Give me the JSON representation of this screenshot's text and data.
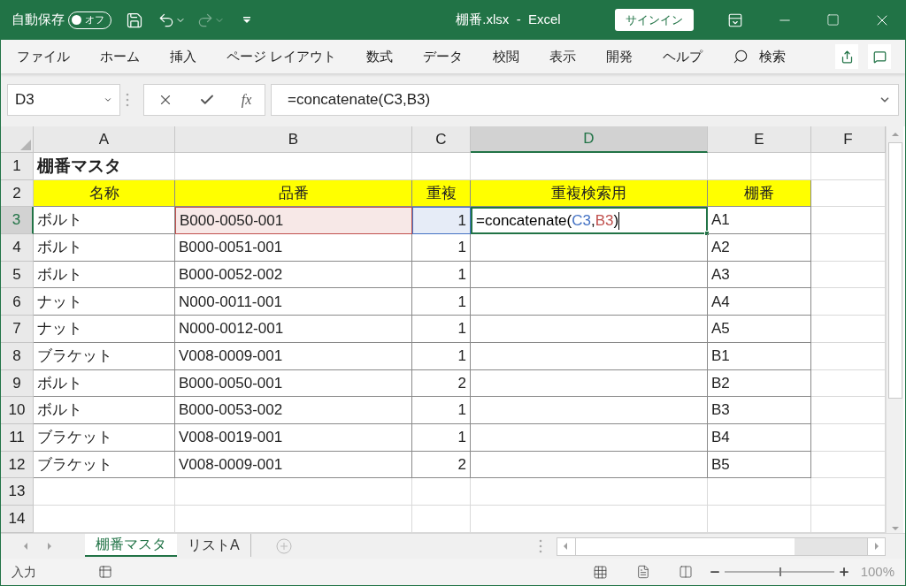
{
  "title_bar": {
    "autosave_label": "自動保存",
    "autosave_toggle": {
      "label": "オフ",
      "on": false
    },
    "redo_disabled": true,
    "title": "棚番.xlsx  -  Excel",
    "signin": "サインイン"
  },
  "ribbon": {
    "tabs": [
      "ファイル",
      "ホーム",
      "挿入",
      "ページ レイアウト",
      "数式",
      "データ",
      "校閲",
      "表示",
      "開発",
      "ヘルプ"
    ],
    "search": "検索"
  },
  "formula_bar": {
    "name_box": "D3",
    "fx": "fx",
    "formula": "=concatenate(C3,B3)"
  },
  "sheet": {
    "columns": [
      {
        "label": "A",
        "selected": false
      },
      {
        "label": "B",
        "selected": false
      },
      {
        "label": "C",
        "selected": false
      },
      {
        "label": "D",
        "selected": true
      },
      {
        "label": "E",
        "selected": false
      },
      {
        "label": "F",
        "selected": false
      }
    ],
    "rows": [
      {
        "header": "1",
        "selected": false,
        "kind": "title",
        "cells": [
          {
            "text": "棚番マスタ"
          },
          {},
          {},
          {},
          {},
          {}
        ]
      },
      {
        "header": "2",
        "selected": false,
        "kind": "header",
        "cells": [
          {
            "text": "名称"
          },
          {
            "text": "品番"
          },
          {
            "text": "重複"
          },
          {
            "text": "重複検索用"
          },
          {
            "text": "棚番"
          },
          {}
        ]
      },
      {
        "header": "3",
        "selected": true,
        "kind": "data",
        "cells": [
          {
            "text": "ボルト"
          },
          {
            "text": "B000-0050-001",
            "color": "#c0504d"
          },
          {
            "text": "1",
            "color": "#4472c4"
          },
          {
            "editing": true,
            "parts": [
              {
                "text": "=concatenate("
              },
              {
                "text": "C3",
                "color": "#4472c4"
              },
              {
                "text": ","
              },
              {
                "text": "B3",
                "color": "#c0504d"
              },
              {
                "text": ")"
              }
            ]
          },
          {
            "text": "A1"
          },
          {}
        ]
      },
      {
        "header": "4",
        "selected": false,
        "kind": "data",
        "cells": [
          {
            "text": "ボルト"
          },
          {
            "text": "B000-0051-001"
          },
          {
            "text": "1"
          },
          {},
          {
            "text": "A2"
          },
          {}
        ]
      },
      {
        "header": "5",
        "selected": false,
        "kind": "data",
        "cells": [
          {
            "text": "ボルト"
          },
          {
            "text": "B000-0052-002"
          },
          {
            "text": "1"
          },
          {},
          {
            "text": "A3"
          },
          {}
        ]
      },
      {
        "header": "6",
        "selected": false,
        "kind": "data",
        "cells": [
          {
            "text": "ナット"
          },
          {
            "text": "N000-0011-001"
          },
          {
            "text": "1"
          },
          {},
          {
            "text": "A4"
          },
          {}
        ]
      },
      {
        "header": "7",
        "selected": false,
        "kind": "data",
        "cells": [
          {
            "text": "ナット"
          },
          {
            "text": "N000-0012-001"
          },
          {
            "text": "1"
          },
          {},
          {
            "text": "A5"
          },
          {}
        ]
      },
      {
        "header": "8",
        "selected": false,
        "kind": "data",
        "cells": [
          {
            "text": "ブラケット"
          },
          {
            "text": "V008-0009-001"
          },
          {
            "text": "1"
          },
          {},
          {
            "text": "B1"
          },
          {}
        ]
      },
      {
        "header": "9",
        "selected": false,
        "kind": "data",
        "cells": [
          {
            "text": "ボルト"
          },
          {
            "text": "B000-0050-001"
          },
          {
            "text": "2"
          },
          {},
          {
            "text": "B2"
          },
          {}
        ]
      },
      {
        "header": "10",
        "selected": false,
        "kind": "data",
        "cells": [
          {
            "text": "ボルト"
          },
          {
            "text": "B000-0053-002"
          },
          {
            "text": "1"
          },
          {},
          {
            "text": "B3"
          },
          {}
        ]
      },
      {
        "header": "11",
        "selected": false,
        "kind": "data",
        "cells": [
          {
            "text": "ブラケット"
          },
          {
            "text": "V008-0019-001"
          },
          {
            "text": "1"
          },
          {},
          {
            "text": "B4"
          },
          {}
        ]
      },
      {
        "header": "12",
        "selected": false,
        "kind": "data",
        "cells": [
          {
            "text": "ブラケット"
          },
          {
            "text": "V008-0009-001"
          },
          {
            "text": "2"
          },
          {},
          {
            "text": "B5"
          },
          {}
        ]
      },
      {
        "header": "13",
        "selected": false,
        "kind": "empty",
        "cells": [
          {},
          {},
          {},
          {},
          {},
          {}
        ]
      },
      {
        "header": "14",
        "selected": false,
        "kind": "empty",
        "cells": [
          {},
          {},
          {},
          {},
          {},
          {}
        ]
      }
    ]
  },
  "sheet_tabs": [
    {
      "label": "棚番マスタ",
      "selected": true
    },
    {
      "label": "リストA",
      "selected": false
    }
  ],
  "status_bar": {
    "mode": "入力",
    "zoom_slider": {
      "level": 0.5
    },
    "zoom": "100%"
  }
}
